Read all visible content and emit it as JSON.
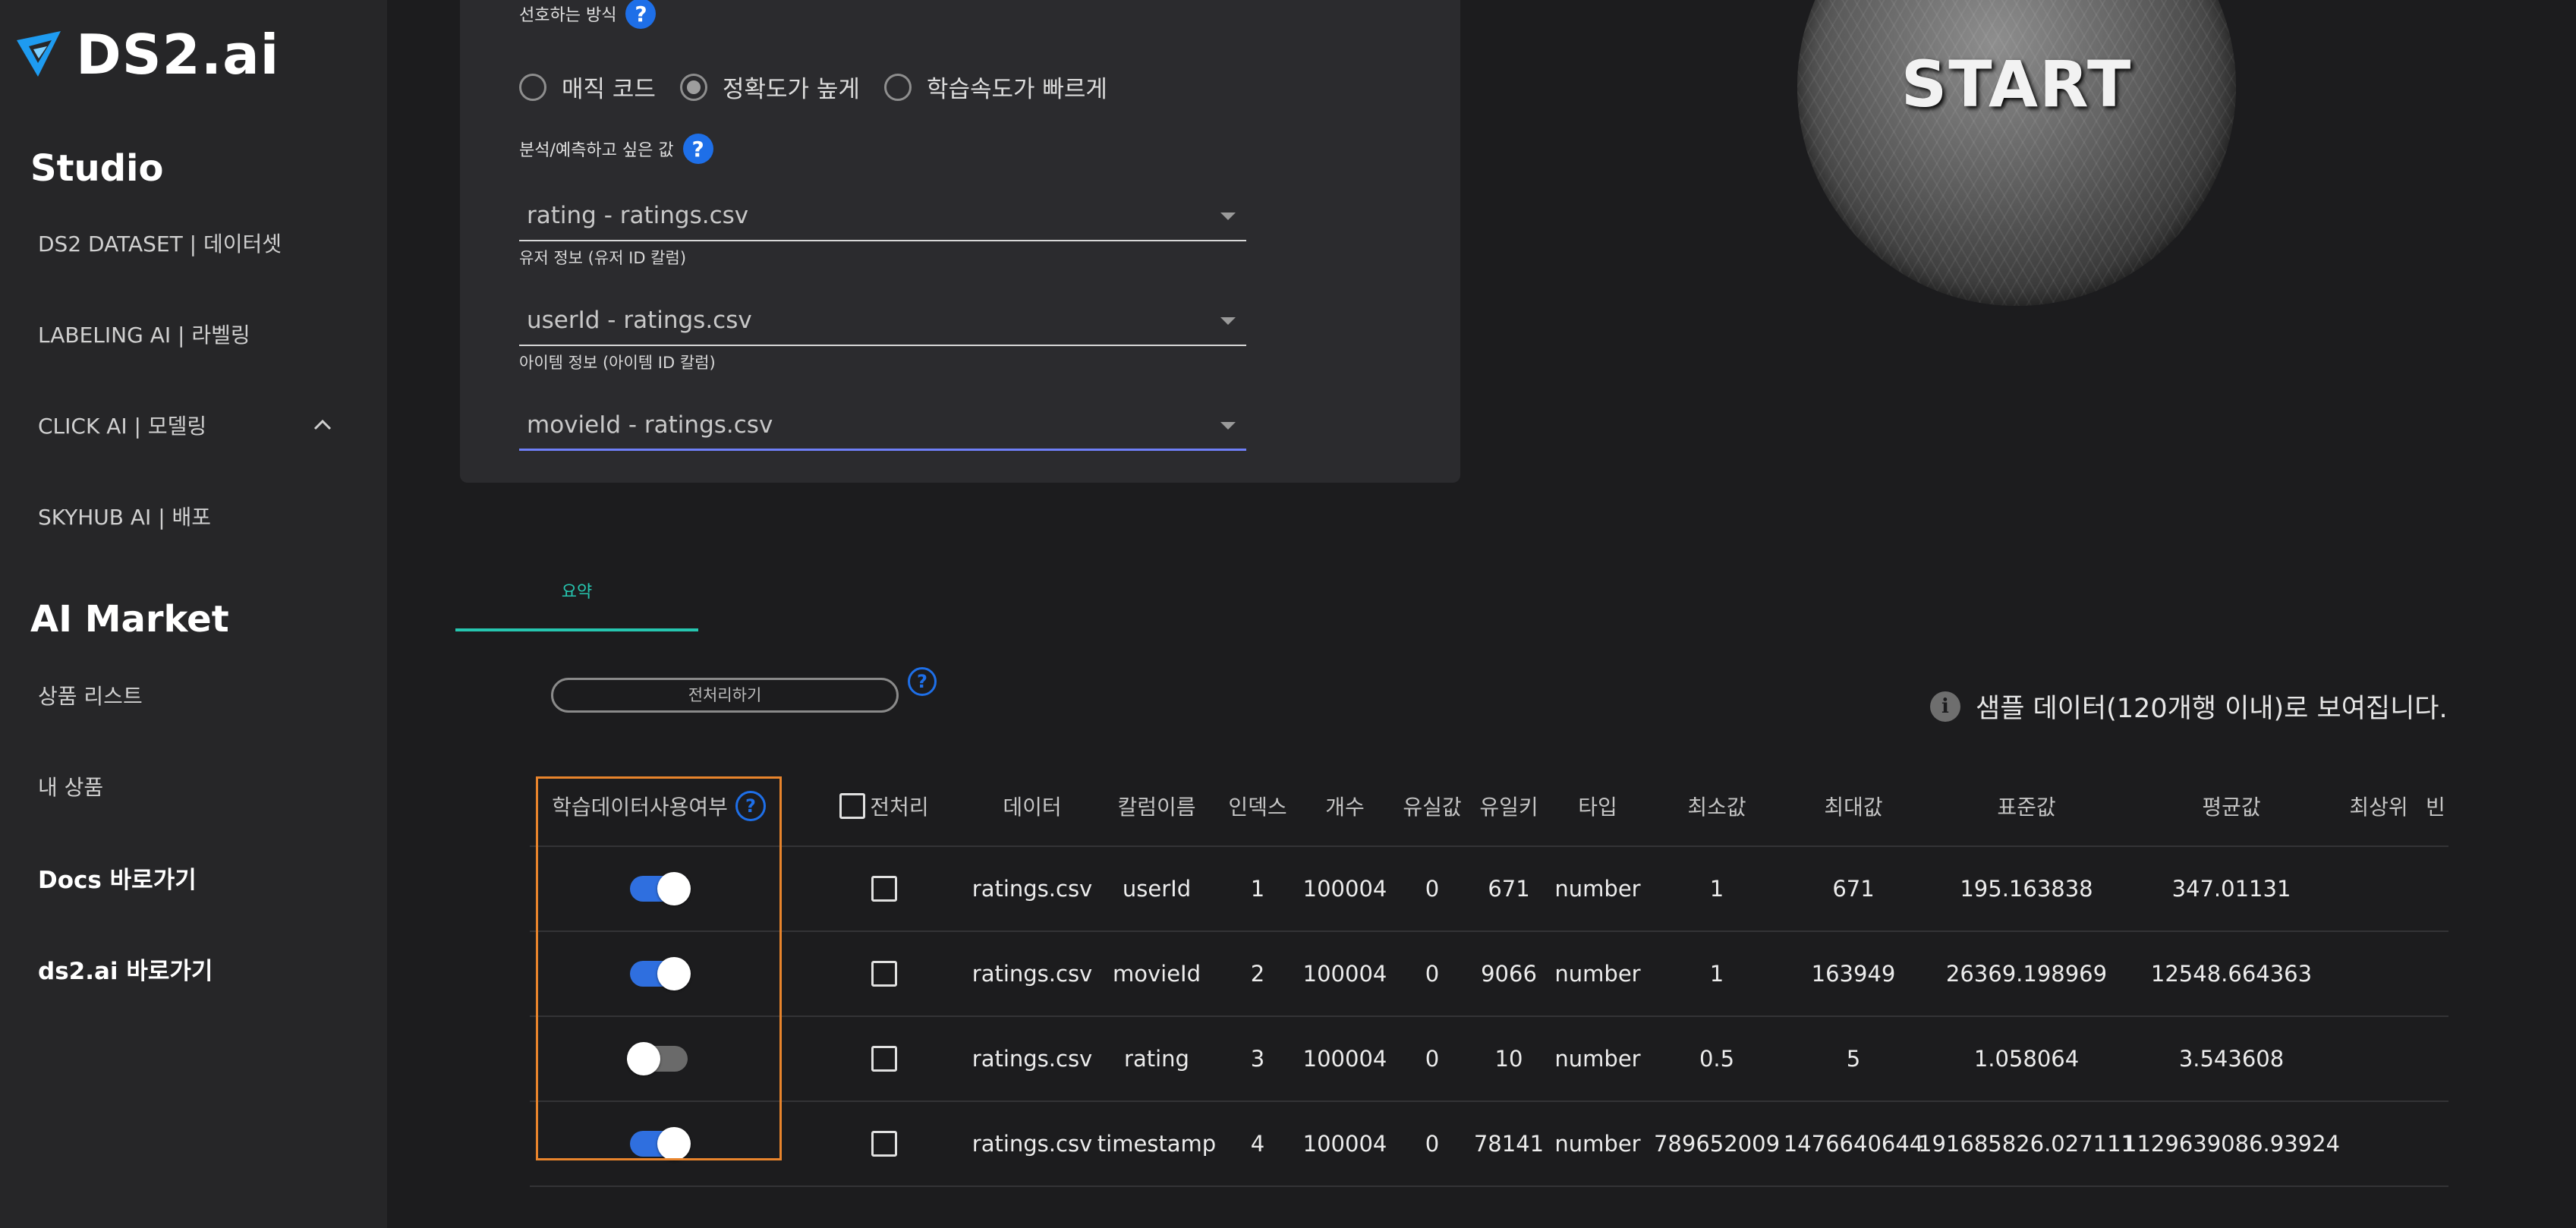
{
  "brand": {
    "logo_text": "DS2.ai",
    "accent": "#1e9bf0"
  },
  "sidebar": {
    "studio_heading": "Studio",
    "studio_items": [
      {
        "label": "DS2 DATASET | 데이터셋"
      },
      {
        "label": "LABELING AI | 라벨링"
      },
      {
        "label": "CLICK AI | 모델링"
      },
      {
        "label": "SKYHUB AI | 배포"
      }
    ],
    "market_heading": "AI Market",
    "market_items": [
      {
        "label": "상품 리스트"
      },
      {
        "label": "내 상품"
      }
    ],
    "links": [
      {
        "label": "Docs 바로가기"
      },
      {
        "label": "ds2.ai 바로가기"
      }
    ]
  },
  "settings": {
    "method_label": "선호하는 방식",
    "methods": [
      "매직 코드",
      "정확도가 높게",
      "학습속도가 빠르게"
    ],
    "selected_method": "정확도가 높게",
    "target_label": "분석/예측하고 싶은 값",
    "target_value": "rating - ratings.csv",
    "user_label": "유저 정보 (유저 ID 칼럼)",
    "user_value": "userId - ratings.csv",
    "item_label": "아이템 정보 (아이템 ID 칼럼)",
    "item_value": "movieId - ratings.csv",
    "help_glyph": "?"
  },
  "start_label": "START",
  "tabs": [
    {
      "label": "요약",
      "active": true
    }
  ],
  "preprocess_button": "전처리하기",
  "sample_notice": "샘플 데이터(120개행 이내)로 보여집니다.",
  "info_glyph": "i",
  "table": {
    "headers": {
      "use": "학습데이터사용여부",
      "preprocess": "전처리",
      "data": "데이터",
      "column": "칼럼이름",
      "index": "인덱스",
      "count": "개수",
      "missing": "유실값",
      "unique": "유일키",
      "type": "타입",
      "min": "최소값",
      "max": "최대값",
      "std": "표준값",
      "mean": "평균값",
      "top": "최상위",
      "freq": "빈"
    },
    "rows": [
      {
        "use": true,
        "data": "ratings.csv",
        "column": "userId",
        "index": "1",
        "count": "100004",
        "missing": "0",
        "unique": "671",
        "type": "number",
        "min": "1",
        "max": "671",
        "std": "195.163838",
        "mean": "347.01131"
      },
      {
        "use": true,
        "data": "ratings.csv",
        "column": "movieId",
        "index": "2",
        "count": "100004",
        "missing": "0",
        "unique": "9066",
        "type": "number",
        "min": "1",
        "max": "163949",
        "std": "26369.198969",
        "mean": "12548.664363"
      },
      {
        "use": false,
        "data": "ratings.csv",
        "column": "rating",
        "index": "3",
        "count": "100004",
        "missing": "0",
        "unique": "10",
        "type": "number",
        "min": "0.5",
        "max": "5",
        "std": "1.058064",
        "mean": "3.543608"
      },
      {
        "use": true,
        "data": "ratings.csv",
        "column": "timestamp",
        "index": "4",
        "count": "100004",
        "missing": "0",
        "unique": "78141",
        "type": "number",
        "min": "789652009",
        "max": "1476640644",
        "std": "191685826.027111",
        "mean": "1129639086.93924"
      }
    ]
  }
}
